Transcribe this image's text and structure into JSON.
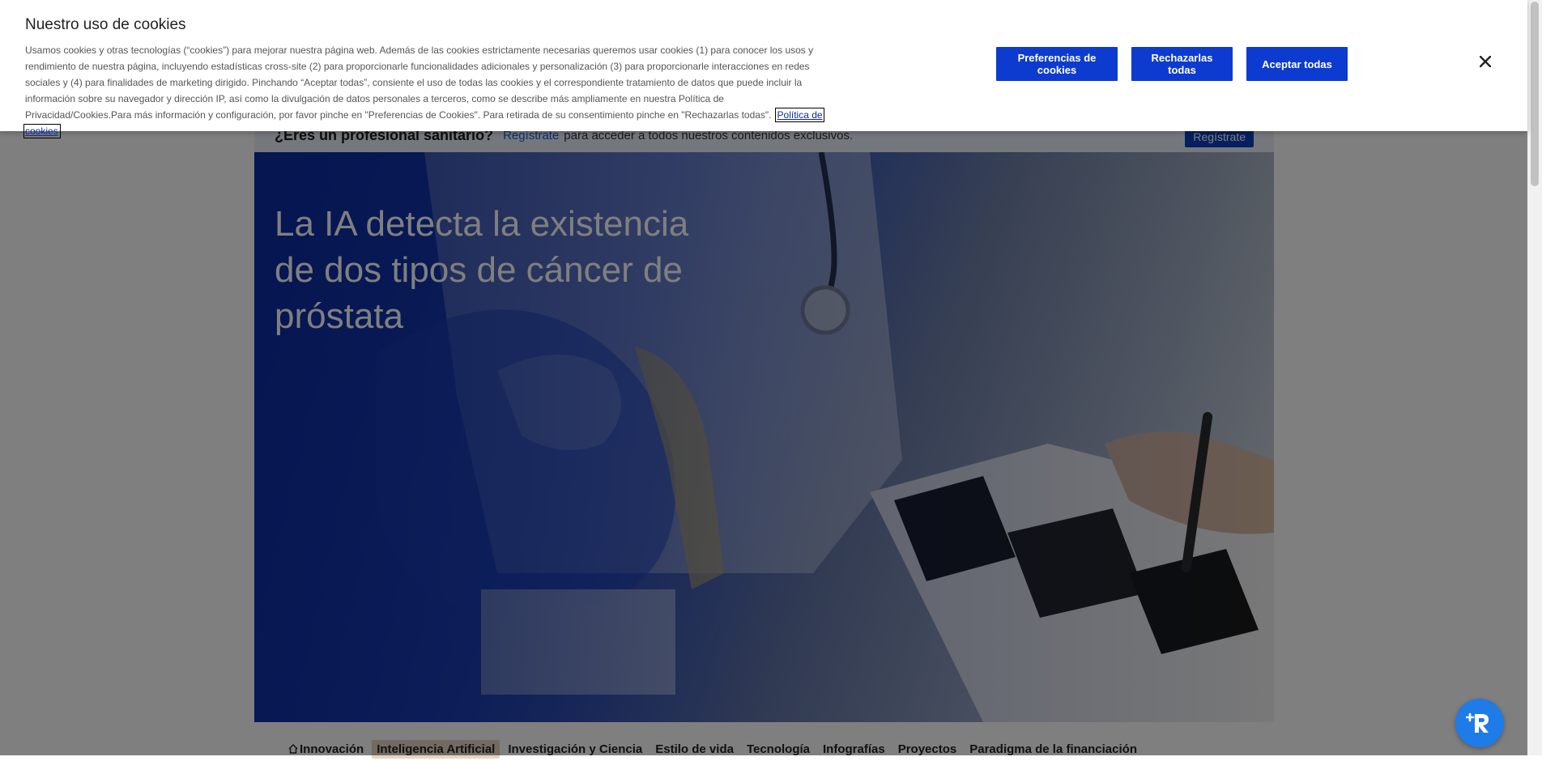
{
  "cookie_banner": {
    "title": "Nuestro uso de cookies",
    "body": "Usamos cookies y otras tecnologías (“cookies”) para mejorar nuestra página web. Además de las cookies estrictamente necesarias queremos usar cookies (1) para conocer los usos y rendimiento de nuestra página, incluyendo estadísticas cross-site (2) para proporcionarle funcionalidades adicionales y personalización (3) para proporcionarle interacciones en redes sociales y (4) para finalidades de marketing dirigido. Pinchando “Aceptar todas”, consiente el uso de todas las cookies y el correspondiente tratamiento de datos que puede incluir la información sobre su navegador y dirección IP, así como la divulgación de datos personales a terceros, como se describe más ampliamente en nuestra Política de Privacidad/Cookies.Para más información y configuración, por favor pinche en \"Preferencias de Cookies\". Para retirada de su consentimiento pinche en \"Rechazarlas todas\".",
    "policy_link": "Política de cookies",
    "preferences_button": "Preferencias de cookies",
    "reject_button": "Rechazarlas todas",
    "accept_button": "Aceptar todas",
    "close_icon": "close-icon",
    "button_color": "#0d3bd0"
  },
  "pro_banner": {
    "question": "¿Eres un profesional sanitario?",
    "register_link": "Regístrate",
    "rest": "para acceder a todos nuestros contenidos exclusivos.",
    "register_button": "Regístrate"
  },
  "hero": {
    "title": "La IA detecta la existencia de dos tipos de cáncer de próstata"
  },
  "nav": {
    "items": [
      {
        "label": "Innovación",
        "icon": "home-icon"
      },
      {
        "label": "Inteligencia Artificial",
        "active": true
      },
      {
        "label": "Investigación y Ciencia"
      },
      {
        "label": "Estilo de vida"
      },
      {
        "label": "Tecnología"
      },
      {
        "label": "Infografías"
      },
      {
        "label": "Proyectos"
      },
      {
        "label": "Paradigma de la financiación"
      }
    ]
  },
  "assistant": {
    "icon": "assistant-icon",
    "color": "#1e7be8"
  }
}
